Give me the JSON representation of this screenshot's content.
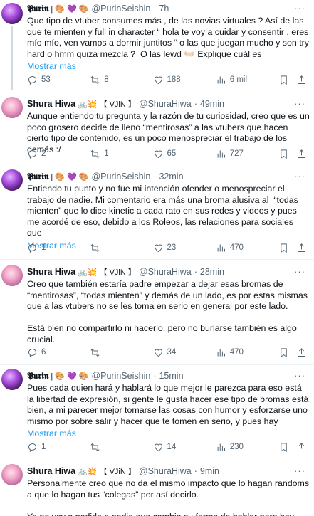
{
  "tweets": [
    {
      "avatar": "purin",
      "name": "𝕻𝖚𝖗𝖎𝖓",
      "name_emojis": "| 🎨 💜 🎨",
      "handle": "@PurinSeishin",
      "time": "7h",
      "text": "Que tipo de vtuber consumes más , de las novias virtuales ? Así de las que te mienten y full in character “ hola te voy a cuidar y consentir , eres mío mío, ven vamos a dormir juntitos “ o las que juegan mucho y son try hard o hmm quizá mezcla ?  O las lewd 👐🏻 Explique cuál es",
      "show_more": "Mostrar más",
      "replies": "53",
      "reposts": "8",
      "likes": "188",
      "views": "6 mil"
    },
    {
      "avatar": "shura",
      "name": "Shura Hiwa",
      "name_emojis": "🚲💥 【 VJiN 】",
      "handle": "@ShuraHiwa",
      "time": "49min",
      "text": "Aunque entiendo tu pregunta y la razón de tu curiosidad, creo que es un poco grosero decirle de lleno “mentirosas” a las vtubers que hacen cierto tipo de contenido, es un poco menospreciar el trabajo de los demás :/",
      "show_more": "",
      "replies": "2",
      "reposts": "1",
      "likes": "65",
      "views": "727"
    },
    {
      "avatar": "purin",
      "name": "𝕻𝖚𝖗𝖎𝖓",
      "name_emojis": "| 🎨 💜 🎨",
      "handle": "@PurinSeishin",
      "time": "32min",
      "text": "Entiendo tu punto y no fue mi intención ofender o menospreciar el trabajo de nadie. Mi comentario era más una broma alusiva al  “todas mienten” que lo dice kinetic a cada rato en sus redes y videos y pues me acordé de eso, debido a los Roleos, las relaciones para sociales que",
      "show_more": "Mostrar más",
      "replies": "1",
      "reposts": "",
      "likes": "23",
      "views": "470"
    },
    {
      "avatar": "shura",
      "name": "Shura Hiwa",
      "name_emojis": "🚲💥 【 VJiN 】",
      "handle": "@ShuraHiwa",
      "time": "28min",
      "text": "Creo que también estaría padre empezar a dejar esas bromas de “mentirosas”, “todas mienten” y demás de un lado, es por estas mismas que a las vtubers no se les toma en serio en general por este lado.\n\nEstá bien no compartirlo ni hacerlo, pero no burlarse también es algo crucial.",
      "show_more": "",
      "replies": "6",
      "reposts": "",
      "likes": "34",
      "views": "470"
    },
    {
      "avatar": "purin",
      "name": "𝕻𝖚𝖗𝖎𝖓",
      "name_emojis": "| 🎨 💜 🎨",
      "handle": "@PurinSeishin",
      "time": "15min",
      "text": "Pues cada quien hará y hablará lo que mejor le parezca para eso está la libertad de expresión, si gente le gusta hacer ese tipo de bromas está bien, a mi parecer mejor tomarse las cosas con humor y esforzarse uno mismo por sobre salir y hacer que te tomen en serio, y pues hay",
      "show_more": "Mostrar más",
      "replies": "1",
      "reposts": "",
      "likes": "14",
      "views": "230"
    },
    {
      "avatar": "shura",
      "name": "Shura Hiwa",
      "name_emojis": "🚲💥 【 VJiN 】",
      "handle": "@ShuraHiwa",
      "time": "9min",
      "text": "Personalmente creo que no da el mismo impacto que lo hagan randoms a que lo hagan tus “colegas” por así decirlo.\n\nYo no voy a pedirle a nadie que cambie su forma de hablar pero hay que",
      "show_more": "",
      "replies": "",
      "reposts": "",
      "likes": "",
      "views": ""
    }
  ]
}
